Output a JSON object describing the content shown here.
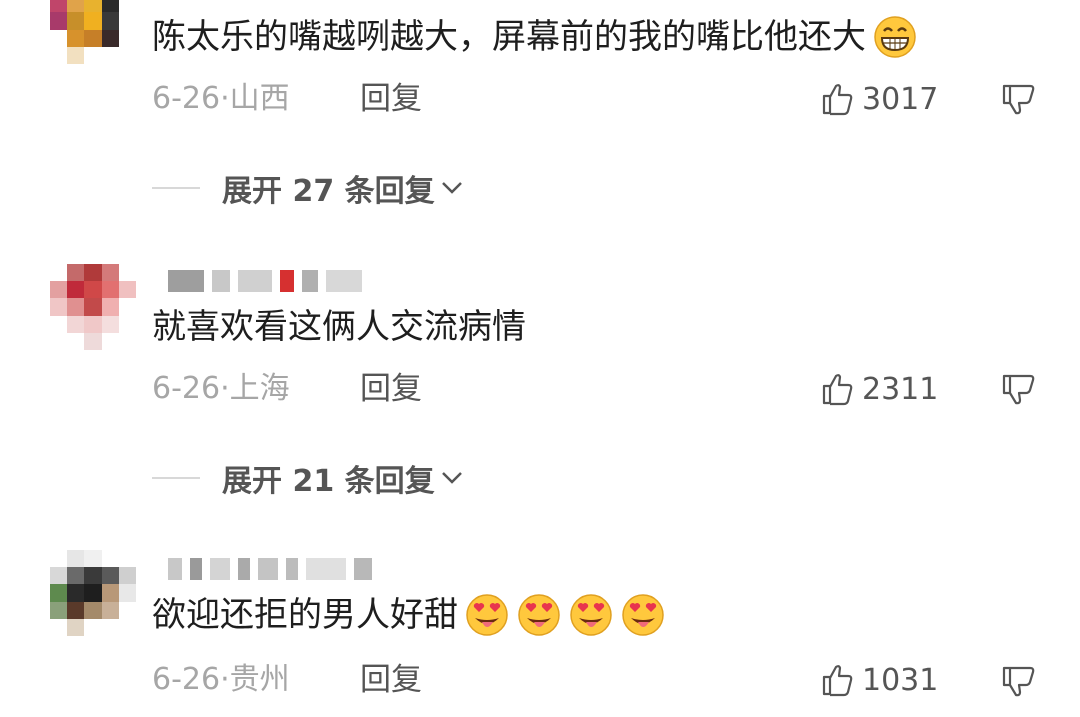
{
  "comments": [
    {
      "text": "陈太乐的嘴越咧越大，屏幕前的我的嘴比他还大",
      "emoji": "grinning-face",
      "date": "6-26",
      "location": "山西",
      "reply_label": "回复",
      "likes": "3017",
      "expand_label": "展开 27 条回复"
    },
    {
      "text": "就喜欢看这俩人交流病情",
      "date": "6-26",
      "location": "上海",
      "reply_label": "回复",
      "likes": "2311",
      "expand_label": "展开 21 条回复"
    },
    {
      "text": "欲迎还拒的男人好甜",
      "emoji": "heart-eyes-tongue-face",
      "emoji_count": 4,
      "date": "6-26",
      "location": "贵州",
      "reply_label": "回复",
      "likes": "1031"
    }
  ],
  "separator": "·",
  "colors": {
    "text": "#1e1e1e",
    "meta": "#a6a6a6",
    "action": "#555555",
    "emoji_yellow": "#ffc83d",
    "emoji_heart": "#e8344e"
  }
}
